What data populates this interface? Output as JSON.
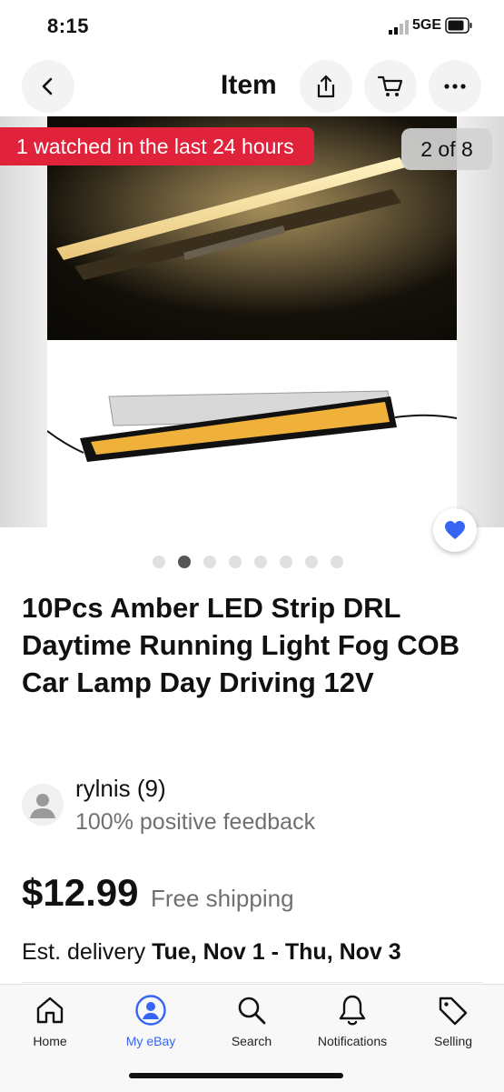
{
  "status": {
    "time": "8:15",
    "network": "5GE"
  },
  "header": {
    "title": "Item"
  },
  "gallery": {
    "watched_text": "1 watched in the last 24 hours",
    "counter": "2 of 8",
    "current_index": 2,
    "total_images": 8
  },
  "listing": {
    "title": "10Pcs Amber LED Strip DRL Daytime Running Light Fog COB Car Lamp Day Driving 12V",
    "price": "$12.99",
    "shipping": "Free shipping",
    "delivery_prefix": "Est. delivery ",
    "delivery_dates": "Tue, Nov 1 - Thu, Nov 3"
  },
  "seller": {
    "name": "rylnis (9)",
    "feedback": "100% positive feedback"
  },
  "tabs": [
    {
      "label": "Home",
      "icon": "home-icon",
      "active": false
    },
    {
      "label": "My eBay",
      "icon": "account-icon",
      "active": true
    },
    {
      "label": "Search",
      "icon": "search-icon",
      "active": false
    },
    {
      "label": "Notifications",
      "icon": "bell-icon",
      "active": false
    },
    {
      "label": "Selling",
      "icon": "tag-icon",
      "active": false
    }
  ],
  "colors": {
    "accent": "#3665f3",
    "badge": "#e0233b"
  }
}
